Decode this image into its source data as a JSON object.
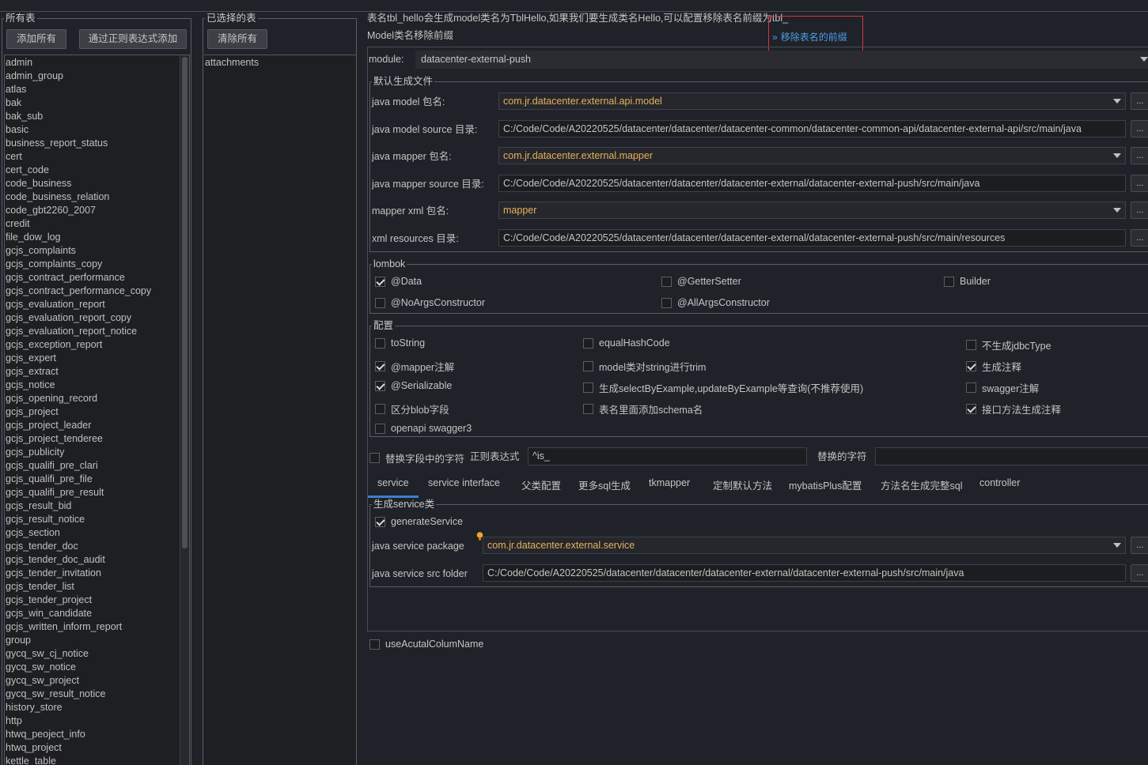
{
  "all_tables": {
    "title": "所有表",
    "add_all_label": "添加所有",
    "add_regex_label": "通过正则表达式添加",
    "items": [
      "admin",
      "admin_group",
      "atlas",
      "bak",
      "bak_sub",
      "basic",
      "business_report_status",
      "cert",
      "cert_code",
      "code_business",
      "code_business_relation",
      "code_gbt2260_2007",
      "credit",
      "file_dow_log",
      "gcjs_complaints",
      "gcjs_complaints_copy",
      "gcjs_contract_performance",
      "gcjs_contract_performance_copy",
      "gcjs_evaluation_report",
      "gcjs_evaluation_report_copy",
      "gcjs_evaluation_report_notice",
      "gcjs_exception_report",
      "gcjs_expert",
      "gcjs_extract",
      "gcjs_notice",
      "gcjs_opening_record",
      "gcjs_project",
      "gcjs_project_leader",
      "gcjs_project_tenderee",
      "gcjs_publicity",
      "gcjs_qualifi_pre_clari",
      "gcjs_qualifi_pre_file",
      "gcjs_qualifi_pre_result",
      "gcjs_result_bid",
      "gcjs_result_notice",
      "gcjs_section",
      "gcjs_tender_doc",
      "gcjs_tender_doc_audit",
      "gcjs_tender_invitation",
      "gcjs_tender_list",
      "gcjs_tender_project",
      "gcjs_win_candidate",
      "gcjs_written_inform_report",
      "group",
      "gycq_sw_cj_notice",
      "gycq_sw_notice",
      "gycq_sw_project",
      "gycq_sw_result_notice",
      "history_store",
      "http",
      "htwq_peoject_info",
      "htwq_project",
      "kettle_table"
    ]
  },
  "selected_tables": {
    "title": "已选择的表",
    "clear_all_label": "清除所有",
    "items": [
      "attachments"
    ]
  },
  "prefix": {
    "hint": "表名tbl_hello会生成model类名为TblHello,如果我们要生成类名Hello,可以配置移除表名前缀为tbl_",
    "label": "Model类名移除前缀",
    "link": "移除表名的前缀",
    "link_arrow": "»"
  },
  "module": {
    "label": "module:",
    "value": "datacenter-external-push"
  },
  "defaults": {
    "title": "默认生成文件",
    "rows": [
      {
        "label": "java model 包名:",
        "value": "com.jr.datacenter.external.api.model",
        "combo": true
      },
      {
        "label": "java model source 目录:",
        "value": "C:/Code/Code/A20220525/datacenter/datacenter/datacenter-common/datacenter-common-api/datacenter-external-api/src/main/java",
        "combo": false
      },
      {
        "label": "java mapper 包名:",
        "value": "com.jr.datacenter.external.mapper",
        "combo": true
      },
      {
        "label": "java mapper source 目录:",
        "value": "C:/Code/Code/A20220525/datacenter/datacenter/datacenter-external/datacenter-external-push/src/main/java",
        "combo": false
      },
      {
        "label": "mapper xml 包名:",
        "value": "mapper",
        "combo": true
      },
      {
        "label": "xml resources 目录:",
        "value": "C:/Code/Code/A20220525/datacenter/datacenter/datacenter-external/datacenter-external-push/src/main/resources",
        "combo": false
      }
    ],
    "browse_label": "..."
  },
  "lombok": {
    "title": "lombok",
    "options": [
      {
        "label": "@Data",
        "checked": true
      },
      {
        "label": "@GetterSetter",
        "checked": false
      },
      {
        "label": "Builder",
        "checked": false
      },
      {
        "label": "@NoArgsConstructor",
        "checked": false
      },
      {
        "label": "@AllArgsConstructor",
        "checked": false
      }
    ]
  },
  "config": {
    "title": "配置",
    "options": [
      {
        "label": "toString",
        "checked": false
      },
      {
        "label": "equalHashCode",
        "checked": false
      },
      {
        "label": "不生成jdbcType",
        "checked": false
      },
      {
        "label": "@mapper注解",
        "checked": true
      },
      {
        "label": "model类对string进行trim",
        "checked": false
      },
      {
        "label": "生成注释",
        "checked": true
      },
      {
        "label": "@Serializable",
        "checked": true
      },
      {
        "label": "生成selectByExample,updateByExample等查询(不推荐使用)",
        "checked": false
      },
      {
        "label": "swagger注解",
        "checked": false
      },
      {
        "label": "区分blob字段",
        "checked": false
      },
      {
        "label": "表名里面添加schema名",
        "checked": false
      },
      {
        "label": "接口方法生成注释",
        "checked": true
      },
      {
        "label": "openapi swagger3",
        "checked": false
      }
    ]
  },
  "replace": {
    "checkbox_label": "替换字段中的字符",
    "checked": false,
    "regex_label": "正则表达式",
    "regex_value": "^is_",
    "replacement_label": "替换的字符",
    "replacement_value": ""
  },
  "tabs": [
    "service",
    "service interface",
    "父类配置",
    "更多sql生成",
    "tkmapper",
    "定制默认方法",
    "mybatisPlus配置",
    "方法名生成完整sql",
    "controller"
  ],
  "active_tab": "service",
  "service": {
    "title": "生成service类",
    "generate_label": "generateService",
    "generate_checked": true,
    "package_label": "java service package",
    "package_value": "com.jr.datacenter.external.service",
    "folder_label": "java service src folder",
    "folder_value": "C:/Code/Code/A20220525/datacenter/datacenter/datacenter-external/datacenter-external-push/src/main/java"
  },
  "use_actual": {
    "label": "useAcutalColumName",
    "checked": false
  },
  "colors": {
    "background": "#1f2228",
    "accent": "#3d7fd0",
    "link": "#4f9ce8",
    "highlight_value": "#e8b05a",
    "annotation": "#d23a3a"
  }
}
